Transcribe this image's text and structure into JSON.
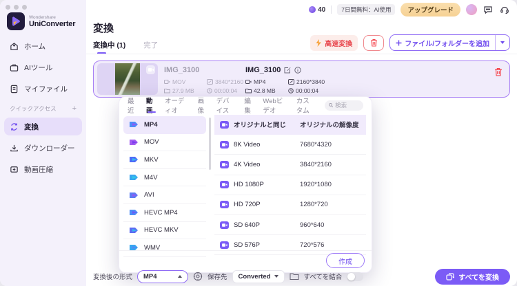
{
  "brand": {
    "company": "Wondershare",
    "product": "UniConverter"
  },
  "topbar": {
    "credits": "40",
    "trial_badge": "7日間無料：AI使用",
    "upgrade_label": "アップグレード"
  },
  "sidebar": {
    "items": [
      {
        "label": "ホーム"
      },
      {
        "label": "AIツール"
      },
      {
        "label": "マイファイル"
      }
    ],
    "quick_access_label": "クイックアクセス",
    "quick_access_add": "+",
    "quick_items": [
      {
        "label": "変換"
      },
      {
        "label": "ダウンローダー"
      },
      {
        "label": "動画圧縮"
      }
    ]
  },
  "header": {
    "title": "変換"
  },
  "tabs": {
    "converting": "変換中 (1)",
    "finished": "完了"
  },
  "actions": {
    "fast_convert": "高速変換",
    "add_files": "ファイル/フォルダーを追加"
  },
  "file_card": {
    "source": {
      "name": "IMG_3100",
      "format": "MOV",
      "resolution": "3840*2160",
      "size": "27.9 MB",
      "duration": "00:00:04"
    },
    "target": {
      "name": "IMG_3100",
      "format": "MP4",
      "resolution": "2160*3840",
      "size": "42.8 MB",
      "duration": "00:00:04"
    }
  },
  "popup": {
    "tabs": [
      "最近",
      "動画",
      "オーディオ",
      "画像",
      "デバイス",
      "編集",
      "Webビデオ",
      "カスタム"
    ],
    "active_tab": "動画",
    "search_placeholder": "検索",
    "formats": [
      "MP4",
      "MOV",
      "MKV",
      "M4V",
      "AVI",
      "HEVC MP4",
      "HEVC MKV",
      "WMV"
    ],
    "selected_format": "MP4",
    "resolutions": [
      {
        "name": "オリジナルと同じ",
        "resolution": "オリジナルの解像度"
      },
      {
        "name": "8K Video",
        "resolution": "7680*4320"
      },
      {
        "name": "4K Video",
        "resolution": "3840*2160"
      },
      {
        "name": "HD 1080P",
        "resolution": "1920*1080"
      },
      {
        "name": "HD 720P",
        "resolution": "1280*720"
      },
      {
        "name": "SD 640P",
        "resolution": "960*640"
      },
      {
        "name": "SD 576P",
        "resolution": "720*576"
      }
    ],
    "create_label": "作成"
  },
  "bottom_bar": {
    "format_label": "変換後の形式",
    "format_value": "MP4",
    "save_label": "保存先",
    "save_value": "Converted",
    "merge_label": "すべてを結合",
    "convert_all_label": "すべてを変換"
  },
  "colors": {
    "accent": "#7C5CF6",
    "danger": "#F4474F",
    "upgrade_bg": "#F8D8A2",
    "card_border": "#A87FF5"
  }
}
